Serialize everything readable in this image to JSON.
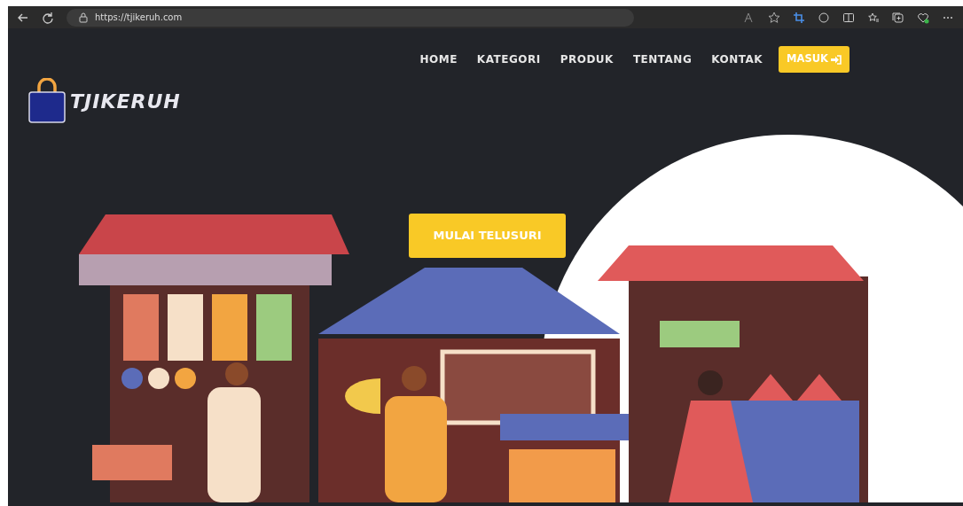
{
  "browser": {
    "url": "https://tjikeruh.com"
  },
  "site": {
    "logo_text": "TJIKERUH",
    "nav": [
      {
        "label": "HOME"
      },
      {
        "label": "KATEGORI"
      },
      {
        "label": "PRODUK"
      },
      {
        "label": "TENTANG"
      },
      {
        "label": "KONTAK"
      }
    ],
    "login_button": "MASUK",
    "cta_button": "MULAI TELUSURI"
  }
}
